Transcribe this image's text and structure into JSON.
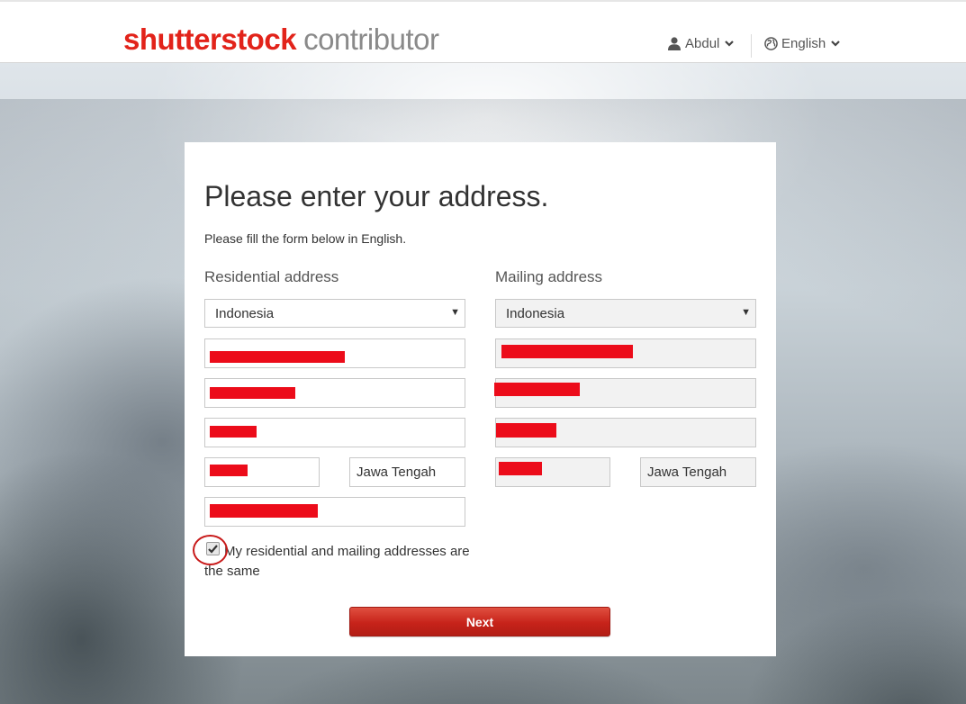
{
  "header": {
    "brand_logo": "shutterstock",
    "brand_sub": "contributor",
    "user_name": "Abdul",
    "language": "English"
  },
  "form": {
    "title": "Please enter your address.",
    "subtitle": "Please fill the form below in English.",
    "residential": {
      "label": "Residential address",
      "country": "Indonesia",
      "state": "Jawa Tengah"
    },
    "mailing": {
      "label": "Mailing address",
      "country": "Indonesia",
      "state": "Jawa Tengah"
    },
    "same_address_label": "My residential and mailing addresses are the same",
    "same_address_checked": true,
    "next_label": "Next"
  },
  "icons": {
    "user": "user-icon",
    "globe": "globe-icon",
    "chevron": "chevron-down-icon",
    "check": "checkmark-icon"
  },
  "colors": {
    "brand_red": "#e2231a",
    "redaction": "#ec0c1a",
    "button_red": "#c7231a"
  }
}
